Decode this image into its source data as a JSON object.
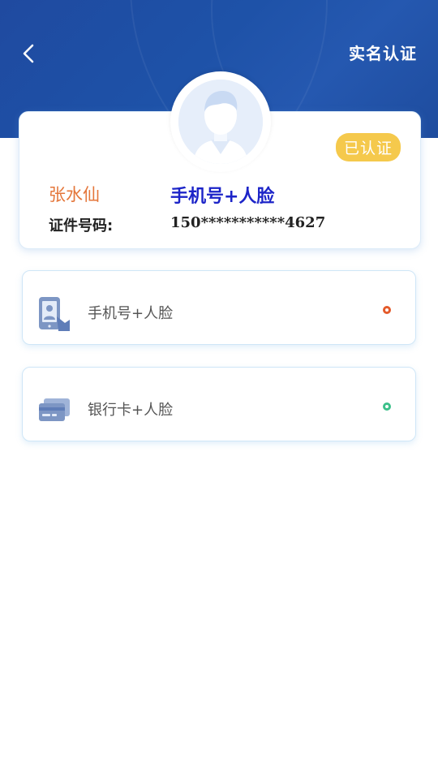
{
  "header": {
    "title": "实名认证",
    "bg_color": "#1f4aa0"
  },
  "profile": {
    "badge": "已认证",
    "name": "张水仙",
    "method": "手机号+人脸",
    "id_label": "证件号码:",
    "id_number": "150***********4627",
    "colors": {
      "name": "#e4763a",
      "method": "#1c24c8",
      "badge": "#f5c94c"
    }
  },
  "options": [
    {
      "label": "手机号+人脸",
      "icon": "phone-face-icon",
      "dot_color": "#e45a2a"
    },
    {
      "label": "银行卡+人脸",
      "icon": "bank-card-icon",
      "dot_color": "#3cc08a"
    }
  ]
}
